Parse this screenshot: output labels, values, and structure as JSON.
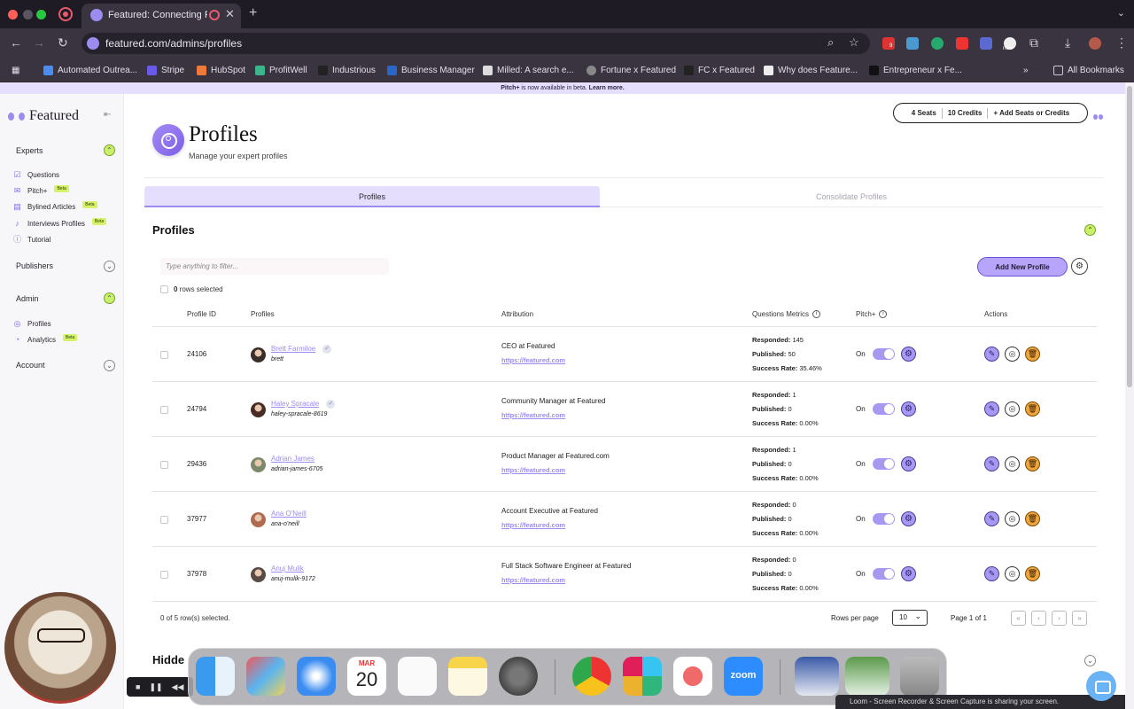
{
  "browser": {
    "tab_title": "Featured: Connecting Pub",
    "url": "featured.com/admins/profiles",
    "ext_badge_1": "9",
    "ext_badge_2": "new",
    "bookmarks": [
      {
        "label": "Automated Outrea...",
        "color": "#4a8cf0"
      },
      {
        "label": "Stripe",
        "color": "#6a5ae8"
      },
      {
        "label": "HubSpot",
        "color": "#f07a3c"
      },
      {
        "label": "ProfitWell",
        "color": "#3cb48c"
      },
      {
        "label": "Industrious",
        "color": "#222222"
      },
      {
        "label": "Business Manager",
        "color": "#2a66c8"
      },
      {
        "label": "Milled: A search e...",
        "color": "#dddddd"
      },
      {
        "label": "Fortune x Featured",
        "color": "#888888"
      },
      {
        "label": "FC x Featured",
        "color": "#222222"
      },
      {
        "label": "Why does Feature...",
        "color": "#eeeeee"
      },
      {
        "label": "Entrepreneur x Fe...",
        "color": "#111111"
      }
    ],
    "bookmarks_more": "»",
    "all_bookmarks": "All Bookmarks"
  },
  "banner": {
    "bold": "Pitch+",
    "text": " is now available in beta. ",
    "link": "Learn more."
  },
  "sidebar": {
    "logo": "Featured",
    "sections": {
      "experts": "Experts",
      "publishers": "Publishers",
      "admin": "Admin",
      "account": "Account"
    },
    "items": {
      "questions": "Questions",
      "pitch": "Pitch+",
      "bylined": "Bylined Articles",
      "interviews": "Interviews Profiles",
      "tutorial": "Tutorial",
      "profiles": "Profiles",
      "analytics": "Analytics"
    },
    "beta": "Beta"
  },
  "header": {
    "seats": "4 Seats",
    "credits": "10 Credits",
    "add_seats": "+ Add Seats or Credits",
    "title": "Profiles",
    "subtitle": "Manage your expert profiles"
  },
  "tabs": {
    "profiles": "Profiles",
    "consolidate": "Consolidate Profiles"
  },
  "section": {
    "title": "Profiles",
    "hidden_title": "Hidde"
  },
  "toolbar": {
    "filter_placeholder": "Type anything to filter...",
    "add_button": "Add New Profile",
    "rows_selected_count": "0",
    "rows_selected_text": "rows selected"
  },
  "table": {
    "columns": {
      "id": "Profile ID",
      "profiles": "Profiles",
      "attribution": "Attribution",
      "metrics": "Questions Metrics",
      "pitch": "Pitch+",
      "actions": "Actions"
    },
    "labels": {
      "responded": "Responded:",
      "published": "Published:",
      "success": "Success Rate:",
      "on": "On"
    },
    "rows": [
      {
        "id": "24106",
        "name": "Brett Farmiloe",
        "handle": "brett",
        "verified": true,
        "title": "CEO at Featured",
        "link": "https://featured.com",
        "responded": "145",
        "published": "50",
        "success": "35.46%",
        "avatar": "#3a2e2a"
      },
      {
        "id": "24794",
        "name": "Haley Spracale",
        "handle": "haley-spracale-8619",
        "verified": true,
        "title": "Community Manager at Featured",
        "link": "https://featured.com",
        "responded": "1",
        "published": "0",
        "success": "0.00%",
        "avatar": "#4a2c26"
      },
      {
        "id": "29436",
        "name": "Adrian James",
        "handle": "adrian-james-6705",
        "verified": false,
        "title": "Product Manager at Featured.com",
        "link": "https://featured.com",
        "responded": "1",
        "published": "0",
        "success": "0.00%",
        "avatar": "#7a8a6a"
      },
      {
        "id": "37977",
        "name": "Ana O'Neill",
        "handle": "ana-o'neill",
        "verified": false,
        "title": "Account Executive at Featured",
        "link": "https://featured.com",
        "responded": "0",
        "published": "0",
        "success": "0.00%",
        "avatar": "#b06a50"
      },
      {
        "id": "37978",
        "name": "Anuj Mulik",
        "handle": "anuj-mulik-9172",
        "verified": false,
        "title": "Full Stack Software Engineer at Featured",
        "link": "https://featured.com",
        "responded": "0",
        "published": "0",
        "success": "0.00%",
        "avatar": "#5a4a44"
      }
    ]
  },
  "footer": {
    "selected": "0 of 5 row(s) selected.",
    "rows_per_page_label": "Rows per page",
    "rows_per_page_value": "10",
    "page_of": "Page 1 of 1"
  },
  "dock": {
    "calendar_month": "MAR",
    "calendar_day": "20",
    "zoom_label": "zoom"
  },
  "loom": {
    "text": "Loom - Screen Recorder & Screen Capture is sharing your screen."
  },
  "colors": {
    "accent": "#9b8cf0",
    "lime": "#c8f06a",
    "delete": "#f0a43c"
  }
}
